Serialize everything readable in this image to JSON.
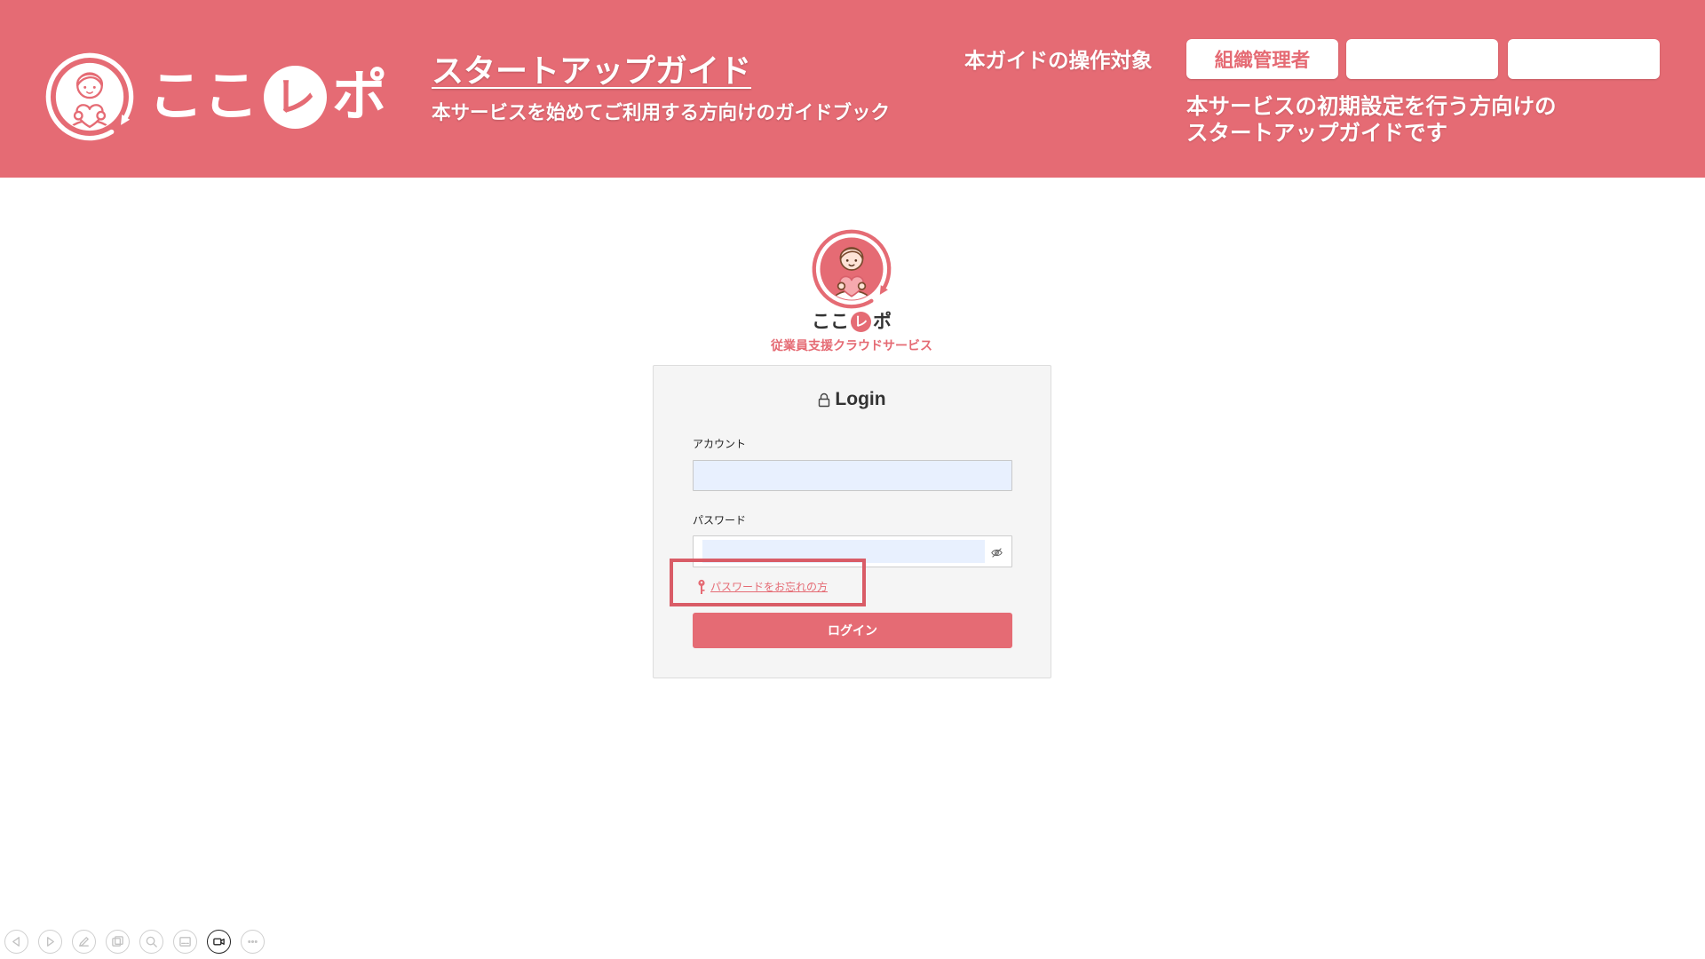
{
  "colors": {
    "brand": "#E56B74",
    "highlight": "#D95C67",
    "autofill": "#E8F0FE",
    "card": "#F5F5F5",
    "text": "#333333"
  },
  "header": {
    "logo": {
      "icon": "kokorepo-logo-icon",
      "pre": "ここ",
      "mark": "レ",
      "post": "ポ"
    },
    "title": "スタートアップガイド",
    "subtitle": "本サービスを始めてご利用する方向けのガイドブック",
    "target_label": "本ガイドの操作対象",
    "target_buttons": [
      {
        "label": "組織管理者"
      },
      {
        "label": ""
      },
      {
        "label": ""
      }
    ],
    "description": [
      "本サービスの初期設定を行う方向けの",
      "スタートアップガイドです"
    ]
  },
  "brand_block": {
    "logo": {
      "icon": "kokorepo-logo-icon",
      "pre": "ここ",
      "mark": "レ",
      "post": "ポ"
    },
    "tagline": "従業員支援クラウドサービス"
  },
  "login_form": {
    "heading_icon": "lock-icon",
    "heading": "Login",
    "account": {
      "label": "アカウント",
      "value": ""
    },
    "password": {
      "label": "パスワード",
      "value": "",
      "toggle_icon": "eye-slash-icon"
    },
    "forgot_password": {
      "icon": "key-icon",
      "label": "パスワードをお忘れの方"
    },
    "submit_label": "ログイン"
  },
  "slideshow_controls": [
    {
      "icon": "previous-icon",
      "active": false
    },
    {
      "icon": "next-icon",
      "active": false
    },
    {
      "icon": "pen-icon",
      "active": false
    },
    {
      "icon": "slides-icon",
      "active": false
    },
    {
      "icon": "zoom-icon",
      "active": false
    },
    {
      "icon": "subtitles-icon",
      "active": false
    },
    {
      "icon": "camera-icon",
      "active": true
    },
    {
      "icon": "more-icon",
      "active": false
    }
  ]
}
